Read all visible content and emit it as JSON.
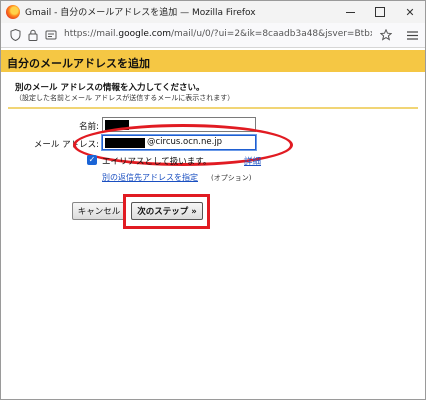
{
  "window": {
    "title": "Gmail - 自分のメールアドレスを追加 — Mozilla Firefox",
    "url_prefix": "https://mail.",
    "url_domain": "google.com",
    "url_rest": "/mail/u/0/?ui=2&ik=8caadb3a48&jsver=Btbx0Bt-"
  },
  "page": {
    "header_title": "自分のメールアドレスを追加",
    "subtitle": "別のメール アドレスの情報を入力してください。",
    "note": "（設定した名前とメール アドレスが送信するメールに表示されます）",
    "name_label": "名前:",
    "email_label": "メール アドレス:",
    "email_value": "@circus.ocn.ne.jp",
    "alias_label": "エイリアスとして扱います。",
    "alias_checked": true,
    "detail_link": "詳細",
    "reply_to_link": "別の返信先アドレスを指定",
    "optional_note": "(オプション)",
    "cancel_button": "キャンセル",
    "next_button": "次のステップ »"
  },
  "colors": {
    "header_band": "#f5c744",
    "annotation_red": "#e11b22",
    "link": "#1a4fc1"
  }
}
